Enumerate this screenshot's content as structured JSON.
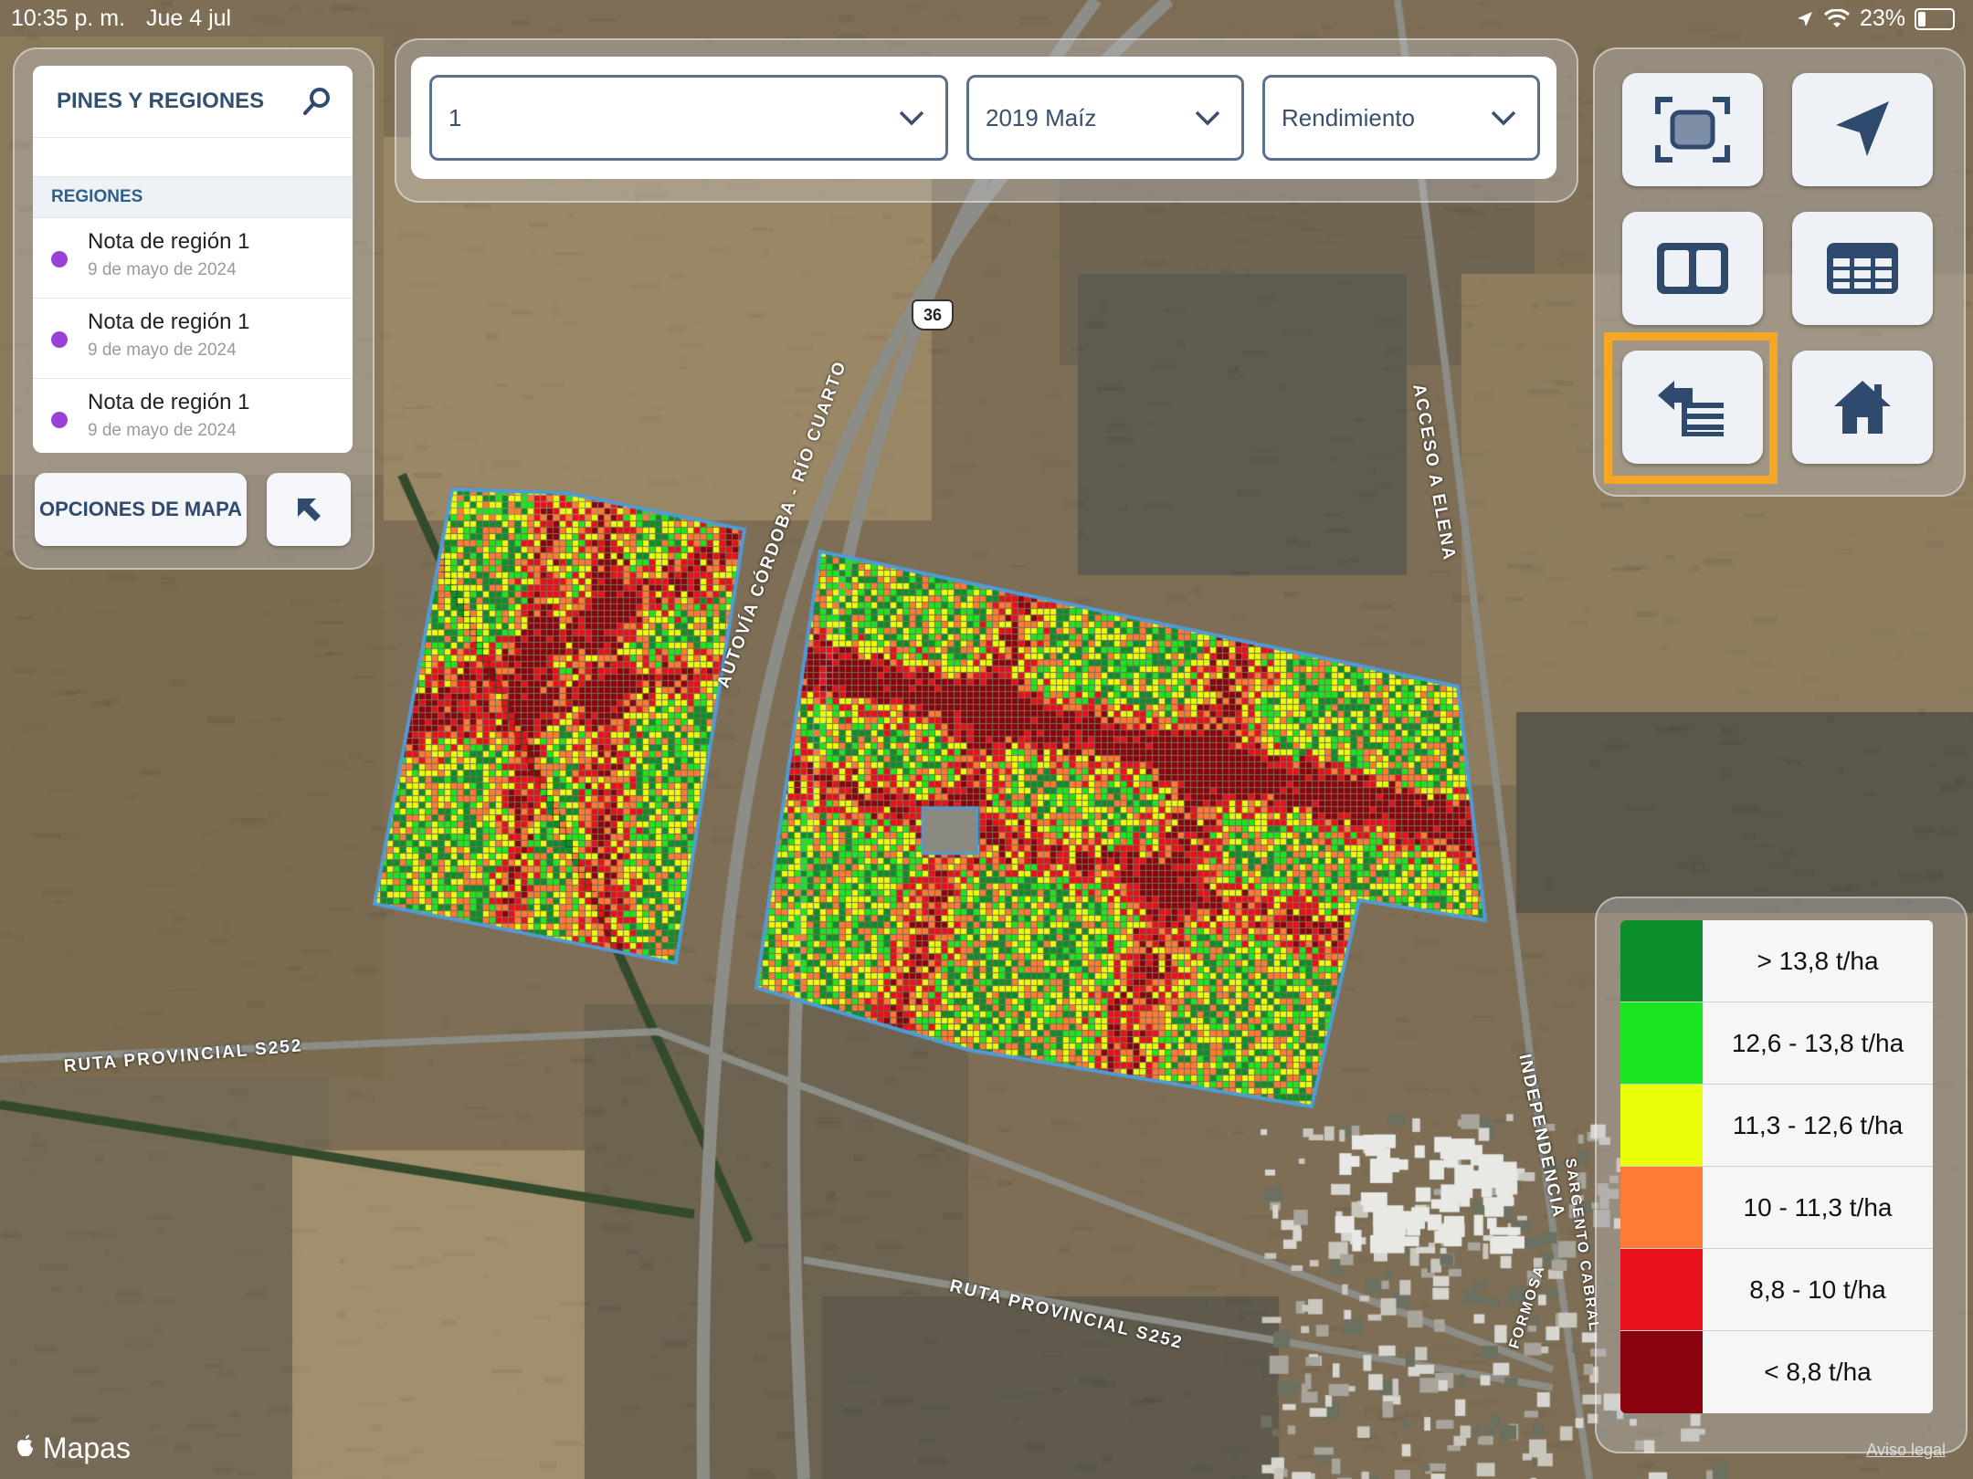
{
  "status": {
    "time": "10:35 p. m.",
    "date": "Jue 4 jul",
    "battery": "23%"
  },
  "pins": {
    "title": "PINES Y REGIONES",
    "regions_header": "REGIONES",
    "regions": [
      {
        "title": "Nota de región 1",
        "date": "9 de mayo de 2024"
      },
      {
        "title": "Nota de región 1",
        "date": "9 de mayo de 2024"
      },
      {
        "title": "Nota de región 1",
        "date": "9 de mayo de 2024"
      }
    ],
    "map_options": "OPCIONES DE MAPA"
  },
  "selectors": {
    "field": "1",
    "season": "2019 Maíz",
    "layer": "Rendimiento"
  },
  "tools": [
    "fit-extent-icon",
    "location-arrow-icon",
    "split-view-icon",
    "table-icon",
    "import-list-icon",
    "home-icon"
  ],
  "legend": [
    {
      "label": "> 13,8 t/ha",
      "color": "#0a8f2a"
    },
    {
      "label": "12,6 - 13,8 t/ha",
      "color": "#19e61f"
    },
    {
      "label": "11,3 - 12,6 t/ha",
      "color": "#eaff0a"
    },
    {
      "label": "10 - 11,3 t/ha",
      "color": "#ff7a33"
    },
    {
      "label": "8,8 - 10 t/ha",
      "color": "#e8101a"
    },
    {
      "label": "< 8,8 t/ha",
      "color": "#8a0410"
    }
  ],
  "map": {
    "roads": {
      "autovia": "AUTOVÍA CÓRDOBA - RÍO CUARTO",
      "acceso": "ACCESO A ELENA",
      "ruta_s252": "RUTA PROVINCIAL S252",
      "independencia": "INDEPENDENCIA",
      "sargento": "SARGENTO CABRAL",
      "formosa": "FORMOSA",
      "route_shield": "36"
    },
    "attribution": "Mapas",
    "legal": "Aviso legal"
  }
}
